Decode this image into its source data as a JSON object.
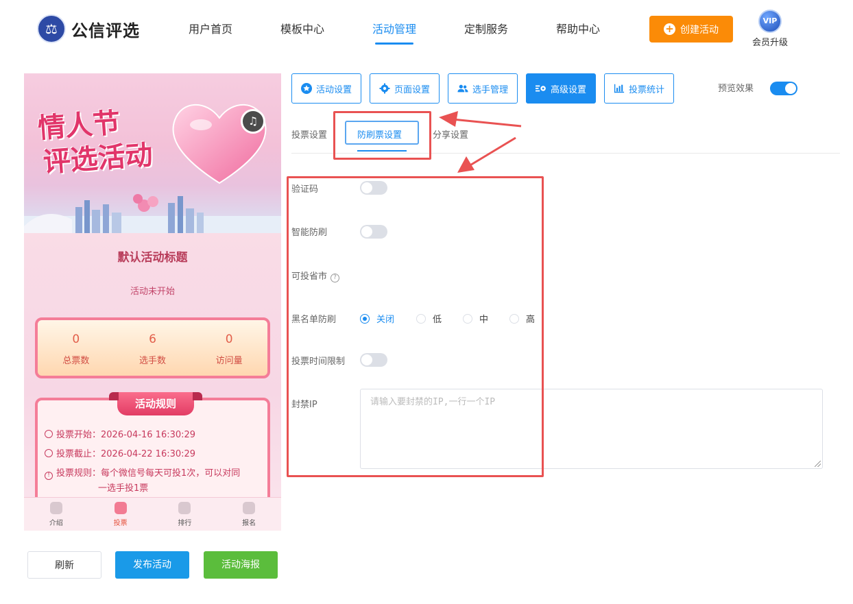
{
  "brand": {
    "name": "公信评选",
    "logo_icon": "scales-of-justice-icon"
  },
  "nav": {
    "items": [
      {
        "label": "用户首页",
        "active": false
      },
      {
        "label": "模板中心",
        "active": false
      },
      {
        "label": "活动管理",
        "active": true
      },
      {
        "label": "定制服务",
        "active": false
      },
      {
        "label": "帮助中心",
        "active": false
      }
    ],
    "create_button": "创建活动",
    "vip_badge": "VIP",
    "vip_label": "会员升级"
  },
  "preview": {
    "banner_line1": "情人节",
    "banner_line2": "评选活动",
    "activity_title": "默认活动标题",
    "activity_status": "活动未开始",
    "stats": [
      {
        "value": "0",
        "label": "总票数"
      },
      {
        "value": "6",
        "label": "选手数"
      },
      {
        "value": "0",
        "label": "访问量"
      }
    ],
    "rules_title": "活动规则",
    "rules": {
      "start": "投票开始：2026-04-16 16:30:29",
      "end": "投票截止：2026-04-22 16:30:29",
      "rule_line1": "投票规则：每个微信号每天可投1次，可以对同",
      "rule_line2": "一选手投1票"
    },
    "tabs": [
      {
        "label": "介绍",
        "active": false
      },
      {
        "label": "投票",
        "active": true
      },
      {
        "label": "排行",
        "active": false
      },
      {
        "label": "报名",
        "active": false
      }
    ]
  },
  "actions": {
    "refresh": "刷新",
    "publish": "发布活动",
    "poster": "活动海报"
  },
  "toolbar": {
    "buttons": [
      {
        "label": "活动设置",
        "icon": "star-icon",
        "active": false
      },
      {
        "label": "页面设置",
        "icon": "gear-icon",
        "active": false
      },
      {
        "label": "选手管理",
        "icon": "users-icon",
        "active": false
      },
      {
        "label": "高级设置",
        "icon": "advanced-settings-icon",
        "active": true
      },
      {
        "label": "投票统计",
        "icon": "bar-chart-icon",
        "active": false
      }
    ],
    "preview_label": "预览效果",
    "preview_on": true
  },
  "subtabs": [
    {
      "label": "投票设置",
      "active": false
    },
    {
      "label": "防刷票设置",
      "active": true
    },
    {
      "label": "分享设置",
      "active": false
    }
  ],
  "form": {
    "captcha_label": "验证码",
    "captcha_on": false,
    "smart_label": "智能防刷",
    "smart_on": false,
    "region_label": "可投省市",
    "blacklist_label": "黑名单防刷",
    "blacklist_options": [
      {
        "label": "关闭",
        "checked": true
      },
      {
        "label": "低",
        "checked": false
      },
      {
        "label": "中",
        "checked": false
      },
      {
        "label": "高",
        "checked": false
      }
    ],
    "time_limit_label": "投票时间限制",
    "time_limit_on": false,
    "ban_ip_label": "封禁IP",
    "ban_ip_placeholder": "请输入要封禁的IP,一行一个IP",
    "ban_ip_value": ""
  },
  "colors": {
    "primary": "#1a8cf0",
    "orange": "#fb8b07",
    "green": "#5bbd3c",
    "annotation_red": "#e95252"
  }
}
